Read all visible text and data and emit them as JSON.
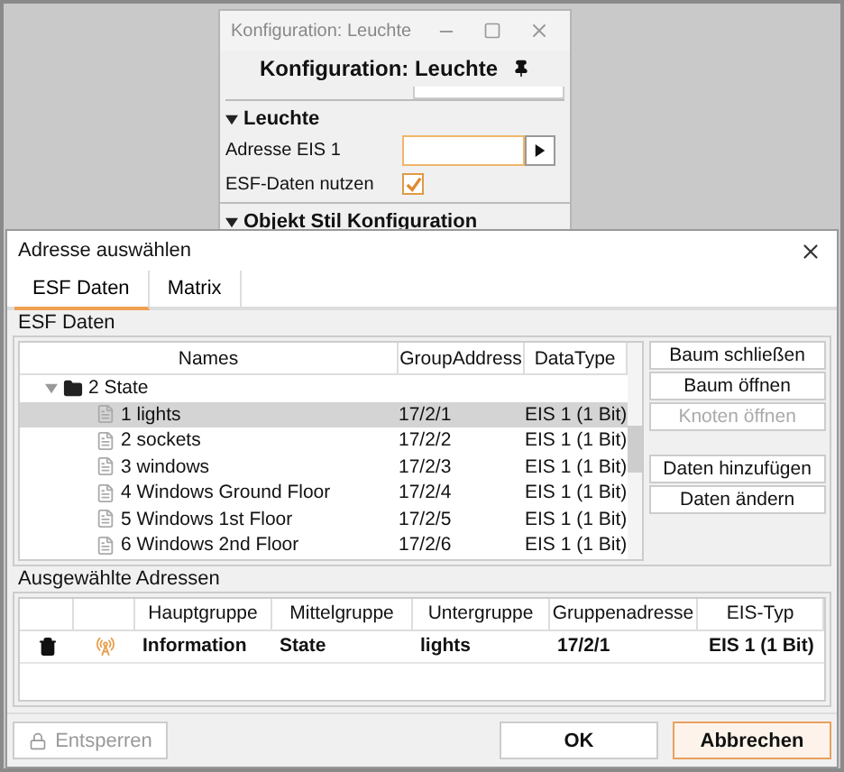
{
  "back_window": {
    "title": "Konfiguration: Leuchte",
    "header": "Konfiguration: Leuchte",
    "sections": [
      {
        "title": "Leuchte",
        "expanded": true,
        "fields": [
          {
            "kind": "address",
            "label": "Adresse EIS 1",
            "focused": true
          },
          {
            "kind": "checkbox",
            "label": "ESF-Daten nutzen",
            "checked": true
          }
        ]
      },
      {
        "title": "Objekt Stil Konfiguration",
        "expanded": true
      }
    ]
  },
  "dialog": {
    "title": "Adresse auswählen",
    "tabs": [
      {
        "label": "ESF Daten",
        "selected": true
      },
      {
        "label": "Matrix",
        "selected": false
      }
    ],
    "esf_group": {
      "title": "ESF Daten",
      "columns": [
        "Names",
        "GroupAddress",
        "DataType"
      ],
      "tree": [
        {
          "name": "2 State",
          "expanded": true,
          "children": [
            {
              "name": "1 lights",
              "address": "17/2/1",
              "type": "EIS 1 (1 Bit)",
              "selected": true
            },
            {
              "name": "2 sockets",
              "address": "17/2/2",
              "type": "EIS 1 (1 Bit)",
              "selected": false
            },
            {
              "name": "3 windows",
              "address": "17/2/3",
              "type": "EIS 1 (1 Bit)",
              "selected": false
            },
            {
              "name": "4 Windows Ground Floor",
              "address": "17/2/4",
              "type": "EIS 1 (1 Bit)",
              "selected": false
            },
            {
              "name": "5 Windows 1st Floor",
              "address": "17/2/5",
              "type": "EIS 1 (1 Bit)",
              "selected": false
            },
            {
              "name": "6 Windows 2nd Floor",
              "address": "17/2/6",
              "type": "EIS 1 (1 Bit)",
              "selected": false
            }
          ]
        }
      ],
      "button_groups": [
        [
          {
            "label": "Baum schließen",
            "disabled": false
          },
          {
            "label": "Baum öffnen",
            "disabled": false
          },
          {
            "label": "Knoten öffnen",
            "disabled": true
          }
        ],
        [
          {
            "label": "Daten hinzufügen",
            "disabled": false
          },
          {
            "label": "Daten ändern",
            "disabled": false
          }
        ]
      ]
    },
    "selected_group": {
      "title": "Ausgewählte Adressen",
      "columns": [
        "Hauptgruppe",
        "Mittelgruppe",
        "Untergruppe",
        "Gruppenadresse",
        "EIS-Typ"
      ],
      "rows": [
        {
          "cells": [
            "Information",
            "State",
            "lights",
            "17/2/1",
            "EIS 1 (1 Bit)"
          ]
        }
      ]
    },
    "footer": {
      "unlock": {
        "label": "Entsperren",
        "disabled": true
      },
      "ok": "OK",
      "cancel": "Abbrechen"
    }
  }
}
